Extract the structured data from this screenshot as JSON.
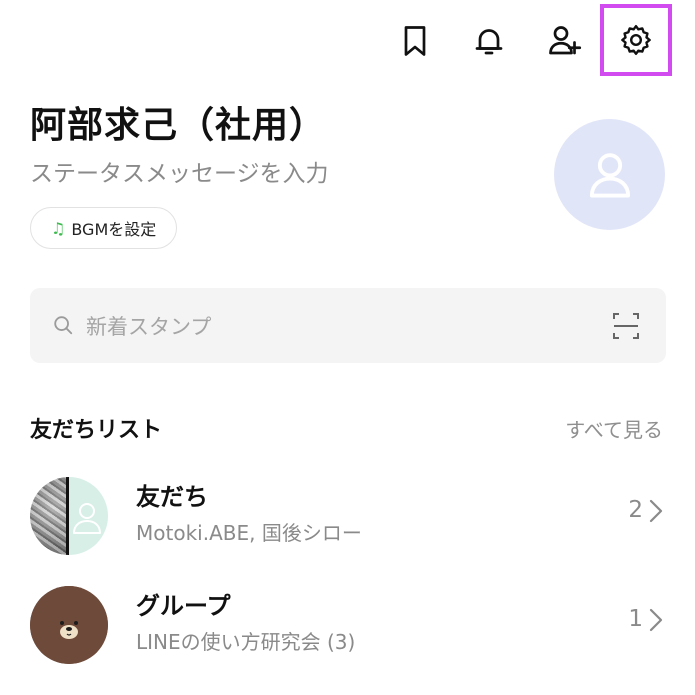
{
  "toolbar": {
    "icons": [
      "bookmark-icon",
      "bell-icon",
      "add-friend-icon",
      "gear-icon"
    ],
    "highlight_color": "#d24bf0"
  },
  "profile": {
    "name": "阿部求己（社用）",
    "status_placeholder": "ステータスメッセージを入力",
    "bgm_label": "BGMを設定",
    "avatar_color": "#e1e5f8"
  },
  "search": {
    "placeholder": "新着スタンプ"
  },
  "friends_section": {
    "title": "友だちリスト",
    "see_all": "すべて見る"
  },
  "list": [
    {
      "title": "友だち",
      "subtitle": "Motoki.ABE, 国後シロー",
      "count": "2"
    },
    {
      "title": "グループ",
      "subtitle": "LINEの使い方研究会 (3)",
      "count": "1"
    }
  ],
  "colors": {
    "accent_green": "#3dbb4f",
    "muted_text": "#8a8a8a",
    "search_bg": "#f4f4f4"
  }
}
